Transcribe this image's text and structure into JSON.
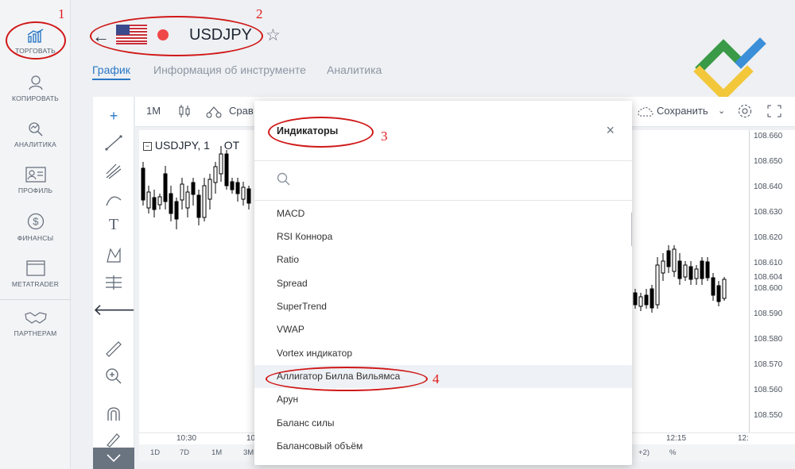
{
  "nav": {
    "items": [
      {
        "label": "ТОРГОВАТЬ",
        "icon": "chart-growth-icon"
      },
      {
        "label": "КОПИРОВАТЬ",
        "icon": "user-copy-icon"
      },
      {
        "label": "АНАЛИТИКА",
        "icon": "analytics-icon"
      },
      {
        "label": "ПРОФИЛЬ",
        "icon": "profile-card-icon"
      },
      {
        "label": "ФИНАНСЫ",
        "icon": "dollar-icon"
      },
      {
        "label": "METATRADER",
        "icon": "window-icon"
      },
      {
        "label": "ПАРТНЕРАМ",
        "icon": "handshake-icon"
      }
    ]
  },
  "header": {
    "symbol": "USDJPY",
    "tabs": [
      "График",
      "Информация об инструменте",
      "Аналитика"
    ]
  },
  "toolbar": {
    "interval": "1M",
    "compare": "Срав",
    "save": "Сохранить"
  },
  "chart": {
    "title": "USDJPY, 1",
    "title_suffix": "ОТ",
    "price_ticks": [
      "108.660",
      "108.650",
      "108.640",
      "108.630",
      "108.620",
      "108.610",
      "108.604",
      "108.600",
      "108.590",
      "108.580",
      "108.570",
      "108.560",
      "108.550"
    ],
    "time_ticks": [
      "10:30",
      "10",
      "12:15",
      "12:"
    ],
    "ranges": [
      "1D",
      "7D",
      "1M",
      "3M"
    ],
    "bottom_right": [
      "+2)",
      "%"
    ]
  },
  "dialog": {
    "title": "Индикаторы",
    "close": "×",
    "items": [
      "MACD",
      "RSI Коннора",
      "Ratio",
      "Spread",
      "SuperTrend",
      "VWAP",
      "Vortex индикатор",
      "Аллигатор Билла Вильямса",
      "Арун",
      "Баланс силы",
      "Балансовый объём"
    ],
    "highlighted_index": 7
  },
  "annotations": [
    "1",
    "2",
    "3",
    "4"
  ]
}
